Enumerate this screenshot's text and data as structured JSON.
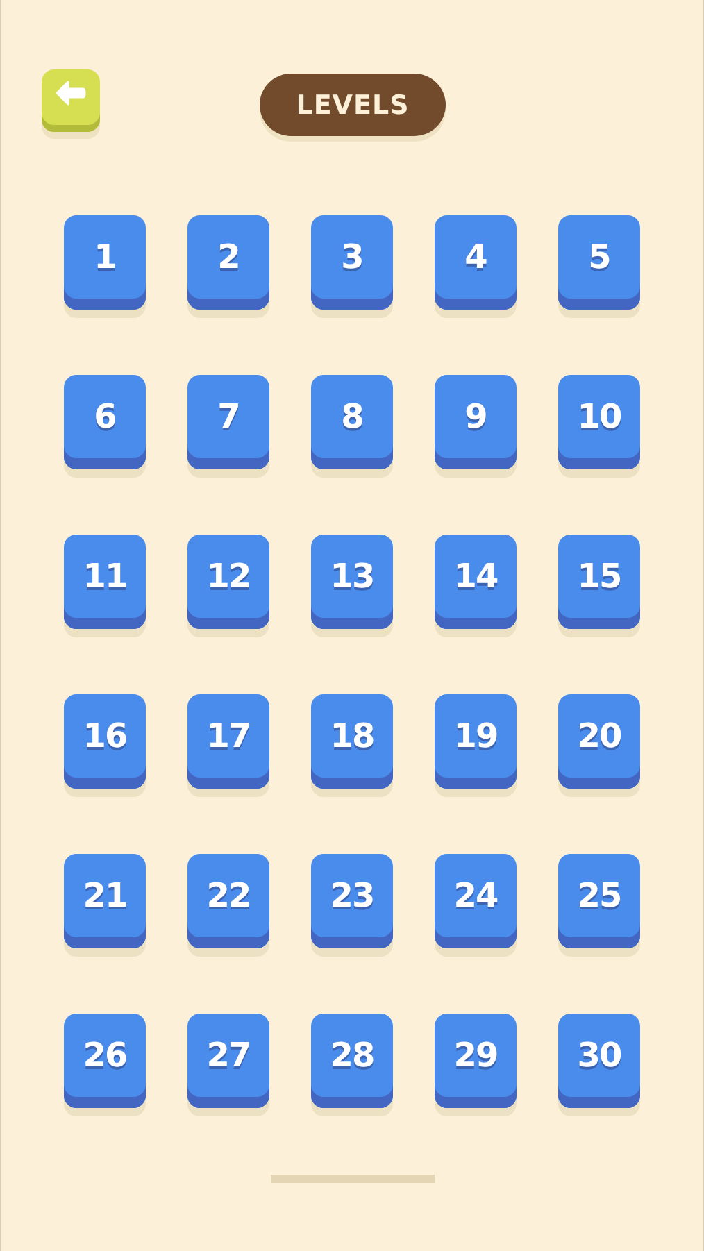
{
  "header": {
    "title": "LEVELS"
  },
  "levels": [
    {
      "label": "1"
    },
    {
      "label": "2"
    },
    {
      "label": "3"
    },
    {
      "label": "4"
    },
    {
      "label": "5"
    },
    {
      "label": "6"
    },
    {
      "label": "7"
    },
    {
      "label": "8"
    },
    {
      "label": "9"
    },
    {
      "label": "10"
    },
    {
      "label": "11"
    },
    {
      "label": "12"
    },
    {
      "label": "13"
    },
    {
      "label": "14"
    },
    {
      "label": "15"
    },
    {
      "label": "16"
    },
    {
      "label": "17"
    },
    {
      "label": "18"
    },
    {
      "label": "19"
    },
    {
      "label": "20"
    },
    {
      "label": "21"
    },
    {
      "label": "22"
    },
    {
      "label": "23"
    },
    {
      "label": "24"
    },
    {
      "label": "25"
    },
    {
      "label": "26"
    },
    {
      "label": "27"
    },
    {
      "label": "28"
    },
    {
      "label": "29"
    },
    {
      "label": "30"
    }
  ]
}
